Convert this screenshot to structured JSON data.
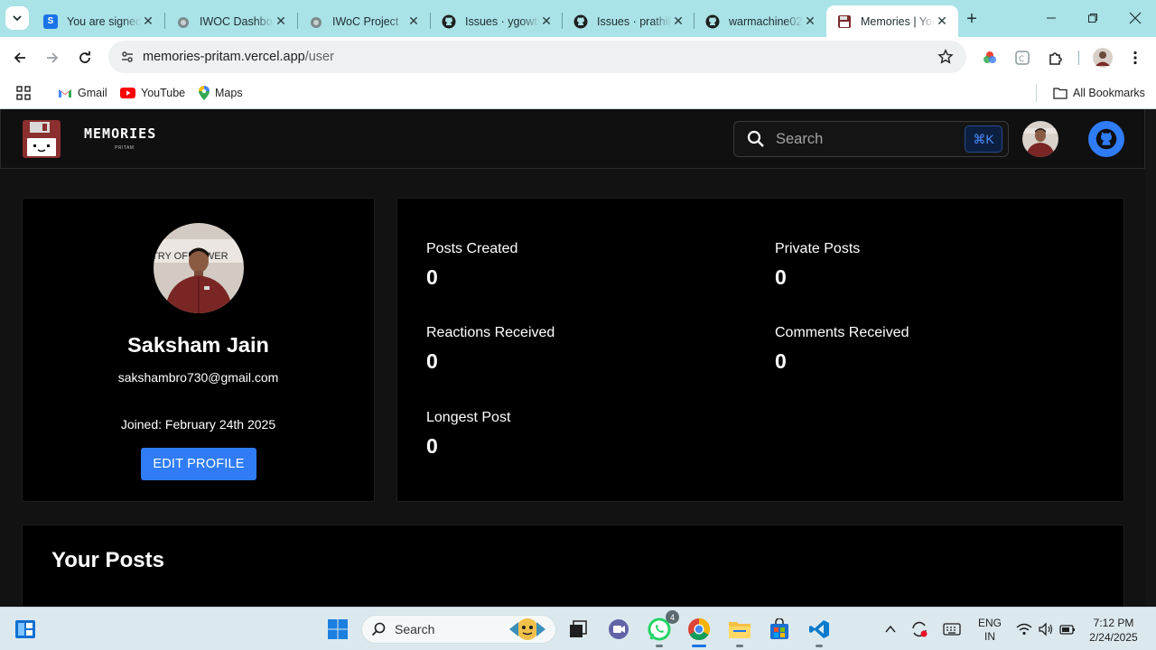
{
  "browser": {
    "tabs": [
      {
        "title": "You are signed in",
        "favicon": "s-icon",
        "color": "#1a73e8",
        "active": false
      },
      {
        "title": "IWOC Dashboard",
        "favicon": "iwoc-icon",
        "active": false
      },
      {
        "title": "IWoC Project ",
        "favicon": "iwoc-icon",
        "active": false
      },
      {
        "title": "Issues · ygowtham",
        "favicon": "github-icon",
        "active": false
      },
      {
        "title": "Issues · prathik",
        "favicon": "github-icon",
        "active": false
      },
      {
        "title": "warmachine02",
        "favicon": "github-icon",
        "active": false
      },
      {
        "title": "Memories | Your",
        "favicon": "memories-icon",
        "active": true
      }
    ],
    "url_host": "memories-pritam.vercel.app",
    "url_path": "/user",
    "bookmarks": [
      {
        "label": "Gmail",
        "icon": "gmail-icon"
      },
      {
        "label": "YouTube",
        "icon": "youtube-icon"
      },
      {
        "label": "Maps",
        "icon": "maps-icon"
      }
    ],
    "all_bookmarks_label": "All Bookmarks"
  },
  "site": {
    "logo_text": "MEMORIES",
    "logo_sub": "PRITAM",
    "search_placeholder": "Search",
    "search_shortcut": "⌘K"
  },
  "profile": {
    "name": "Saksham Jain",
    "email": "sakshambro730@gmail.com",
    "joined": "Joined: February 24th 2025",
    "edit_label": "EDIT PROFILE",
    "photo_text": "TRY OF POWER"
  },
  "stats": [
    {
      "label": "Posts Created",
      "value": "0"
    },
    {
      "label": "Private Posts",
      "value": "0"
    },
    {
      "label": "Reactions Received",
      "value": "0"
    },
    {
      "label": "Comments Received",
      "value": "0"
    },
    {
      "label": "Longest Post",
      "value": "0"
    }
  ],
  "posts_section": {
    "title": "Your Posts"
  },
  "taskbar": {
    "search_placeholder": "Search",
    "whatsapp_badge": "4",
    "lang_line1": "ENG",
    "lang_line2": "IN",
    "time": "7:12 PM",
    "date": "2/24/2025"
  },
  "colors": {
    "accent": "#2f7cf6",
    "chrome_tabstrip": "#a9e2e7",
    "page_bg": "#121212"
  }
}
